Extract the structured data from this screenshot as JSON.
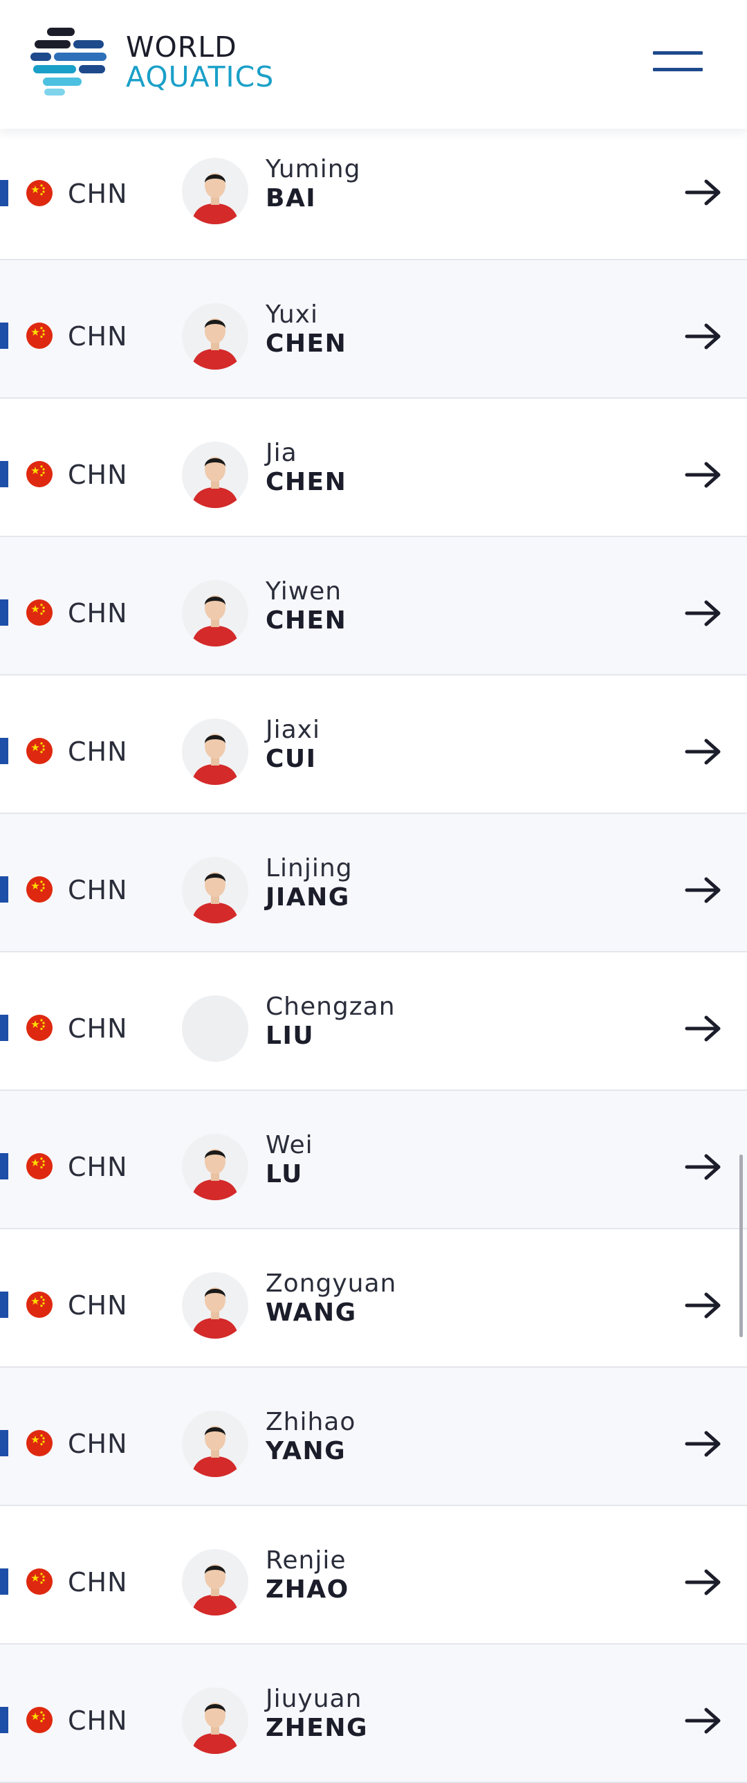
{
  "header": {
    "brand_line1": "WORLD",
    "brand_line2": "AQUATICS",
    "logo_icon": "world-aquatics-logo",
    "menu_icon": "hamburger-menu-icon"
  },
  "colors": {
    "brand_blue": "#1e4a8c",
    "brand_cyan": "#1aa0c8",
    "row_accent": "#1e4fa8",
    "alt_row_bg": "#f7f8fb"
  },
  "athletes": [
    {
      "country": "CHN",
      "given": "Yuming",
      "family": "BAI",
      "has_photo": true
    },
    {
      "country": "CHN",
      "given": "Yuxi",
      "family": "CHEN",
      "has_photo": true
    },
    {
      "country": "CHN",
      "given": "Jia",
      "family": "CHEN",
      "has_photo": true
    },
    {
      "country": "CHN",
      "given": "Yiwen",
      "family": "CHEN",
      "has_photo": true
    },
    {
      "country": "CHN",
      "given": "Jiaxi",
      "family": "CUI",
      "has_photo": true
    },
    {
      "country": "CHN",
      "given": "Linjing",
      "family": "JIANG",
      "has_photo": true
    },
    {
      "country": "CHN",
      "given": "Chengzan",
      "family": "LIU",
      "has_photo": false
    },
    {
      "country": "CHN",
      "given": "Wei",
      "family": "LU",
      "has_photo": true
    },
    {
      "country": "CHN",
      "given": "Zongyuan",
      "family": "WANG",
      "has_photo": true
    },
    {
      "country": "CHN",
      "given": "Zhihao",
      "family": "YANG",
      "has_photo": true
    },
    {
      "country": "CHN",
      "given": "Renjie",
      "family": "ZHAO",
      "has_photo": true
    },
    {
      "country": "CHN",
      "given": "Jiuyuan",
      "family": "ZHENG",
      "has_photo": true
    }
  ]
}
